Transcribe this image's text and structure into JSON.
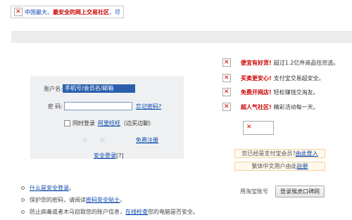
{
  "banner": {
    "text_pre": "中国最大、",
    "text_bold": "最安全的网上交易社区",
    "text_post": "，尽"
  },
  "login": {
    "account_label": "账户名:",
    "account_value": "手机号/会员名/邮箱",
    "password_label": "密  码:",
    "password_value": "",
    "forgot_password": "忘记密码?",
    "sync_login_label": "同时登录",
    "aliwangwang": "阿里旺旺",
    "sync_login_suffix": "（边买边聊）",
    "free_register": "免费注册",
    "secure_login": "安全登录",
    "secure_login_suffix": "[?]"
  },
  "promos": [
    {
      "icon": "broken-image-icon",
      "title": "便宜有好货!",
      "text": "超过1.2亿件商品任您选。"
    },
    {
      "icon": "broken-image-icon",
      "title": "买卖更安心!",
      "text": "支付宝交易超安全。"
    },
    {
      "icon": "broken-image-icon",
      "title": "免费开网店!",
      "text": "轻松赚钱交淘友。"
    },
    {
      "icon": "broken-image-icon",
      "title": "超人气社区!",
      "text": "精彩活动每一天。"
    }
  ],
  "member": {
    "alipay_prefix": "您已经是支付宝会员?",
    "alipay_link": "由此登入",
    "trad_prefix": "繁体中文用户由此",
    "trad_link": "註册"
  },
  "taobao": {
    "label": "用淘宝账号",
    "button": "登录猴虎口碑网"
  },
  "tips": [
    {
      "link": "什么是安全登录",
      "after": "。"
    },
    {
      "before": "保护您的密码，请阅读",
      "link": "密码安全贴士",
      "after": "。"
    },
    {
      "before": "防止病毒或者木马窃取您的账户信息，",
      "link": "在线检查",
      "after": "您的电脑是否安全。"
    }
  ]
}
